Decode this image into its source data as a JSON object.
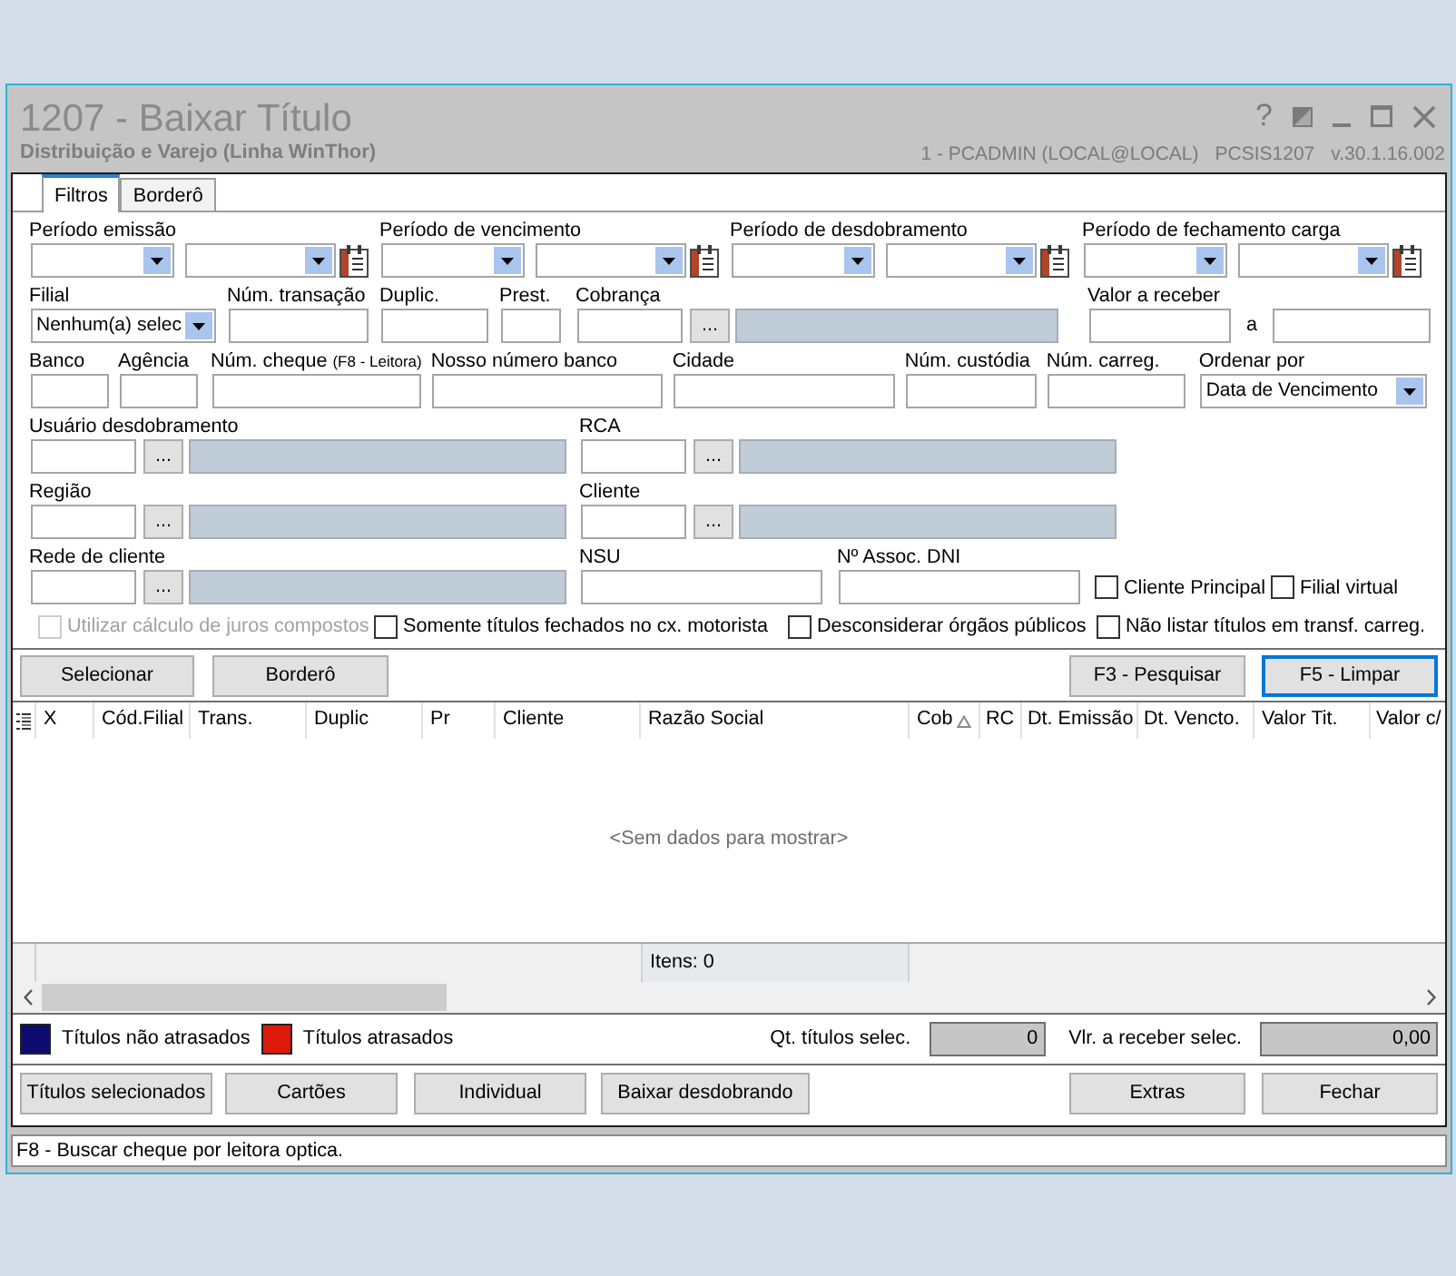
{
  "window": {
    "title": "1207 - Baixar Título",
    "subtitle": "Distribuição e Varejo (Linha WinThor)",
    "help_button": "?",
    "session": "1 - PCADMIN (LOCAL@LOCAL)",
    "program": "PCSIS1207",
    "version": "v.30.1.16.002"
  },
  "tabs": [
    {
      "label": "Filtros",
      "selected": true
    },
    {
      "label": "Borderô",
      "selected": false
    }
  ],
  "filters": {
    "rows": [
      {
        "fields": [
          {
            "kind": "date_range",
            "label": "Período emissão"
          },
          {
            "kind": "date_range",
            "label": "Período de vencimento"
          },
          {
            "kind": "date_range",
            "label": "Período de desdobramento"
          },
          {
            "kind": "date_range",
            "label": "Período de fechamento carga"
          }
        ]
      },
      {
        "fields": [
          {
            "kind": "combo",
            "label": "Filial",
            "value": "Nenhum(a) selec"
          },
          {
            "kind": "text",
            "label": "Núm. transação"
          },
          {
            "kind": "text",
            "label": "Duplic."
          },
          {
            "kind": "text",
            "label": "Prest."
          },
          {
            "kind": "lookup",
            "label": "Cobrança",
            "button": "..."
          },
          {
            "kind": "value_range",
            "label": "Valor a receber",
            "separator": "a"
          }
        ]
      },
      {
        "fields": [
          {
            "kind": "text",
            "label": "Banco"
          },
          {
            "kind": "text",
            "label": "Agência"
          },
          {
            "kind": "text",
            "label": "Núm. cheque",
            "hint": "(F8 - Leitora)"
          },
          {
            "kind": "text",
            "label": "Nosso número banco"
          },
          {
            "kind": "text",
            "label": "Cidade"
          },
          {
            "kind": "text",
            "label": "Núm. custódia"
          },
          {
            "kind": "text",
            "label": "Núm. carreg."
          },
          {
            "kind": "select",
            "label": "Ordenar por",
            "value": "Data de Vencimento"
          }
        ]
      },
      {
        "fields": [
          {
            "kind": "lookup",
            "label": "Usuário desdobramento",
            "button": "..."
          },
          {
            "kind": "lookup",
            "label": "RCA",
            "button": "..."
          }
        ]
      },
      {
        "fields": [
          {
            "kind": "lookup",
            "label": "Região",
            "button": "..."
          },
          {
            "kind": "lookup",
            "label": "Cliente",
            "button": "..."
          }
        ]
      },
      {
        "fields": [
          {
            "kind": "lookup",
            "label": "Rede de cliente",
            "button": "..."
          },
          {
            "kind": "text",
            "label": "NSU"
          },
          {
            "kind": "text",
            "label": "Nº Assoc. DNI"
          },
          {
            "kind": "checkbox",
            "label": "Cliente Principal",
            "checked": false
          },
          {
            "kind": "checkbox",
            "label": "Filial virtual",
            "checked": false
          }
        ]
      }
    ]
  },
  "options": [
    {
      "label": "Utilizar cálculo de juros compostos",
      "checked": false,
      "disabled": true
    },
    {
      "label": "Somente títulos fechados no cx. motorista",
      "checked": false,
      "disabled": false
    },
    {
      "label": "Desconsiderar órgãos públicos",
      "checked": false,
      "disabled": false
    },
    {
      "label": "Não listar títulos em transf. carreg.",
      "checked": false,
      "disabled": false
    }
  ],
  "search_buttons": {
    "left": [
      {
        "label": "Selecionar",
        "focused": false
      },
      {
        "label": "Borderô",
        "focused": false
      }
    ],
    "right": [
      {
        "label": "F3 - Pesquisar",
        "focused": false
      },
      {
        "label": "F5 - Limpar",
        "focused": true
      }
    ]
  },
  "grid": {
    "columns": [
      {
        "label": "X",
        "sorted": false
      },
      {
        "label": "Cód.Filial",
        "sorted": false
      },
      {
        "label": "Trans.",
        "sorted": false
      },
      {
        "label": "Duplic",
        "sorted": false
      },
      {
        "label": "Pr",
        "sorted": false
      },
      {
        "label": "Cliente",
        "sorted": false
      },
      {
        "label": "Razão Social",
        "sorted": false
      },
      {
        "label": "Cob",
        "sorted": true
      },
      {
        "label": "RC",
        "sorted": false
      },
      {
        "label": "Dt. Emissão",
        "sorted": false
      },
      {
        "label": "Dt. Vencto.",
        "sorted": false
      },
      {
        "label": "Valor Tit.",
        "sorted": false
      },
      {
        "label": "Valor c/",
        "sorted": false
      }
    ],
    "empty_message": "<Sem dados para mostrar>",
    "footer": "Itens: 0"
  },
  "legend": [
    {
      "label": "Títulos não atrasados",
      "color": "#0c0c70"
    },
    {
      "label": "Títulos atrasados",
      "color": "#dd1a0b"
    }
  ],
  "totals": [
    {
      "label": "Qt. títulos selec.",
      "value": "0"
    },
    {
      "label": "Vlr. a receber selec.",
      "value": "0,00"
    }
  ],
  "action_buttons": {
    "left": [
      "Títulos selecionados",
      "Cartões",
      "Individual",
      "Baixar desdobrando"
    ],
    "right": [
      "Extras",
      "Fechar"
    ]
  },
  "status_bar": "F8 - Buscar cheque por leitora optica."
}
